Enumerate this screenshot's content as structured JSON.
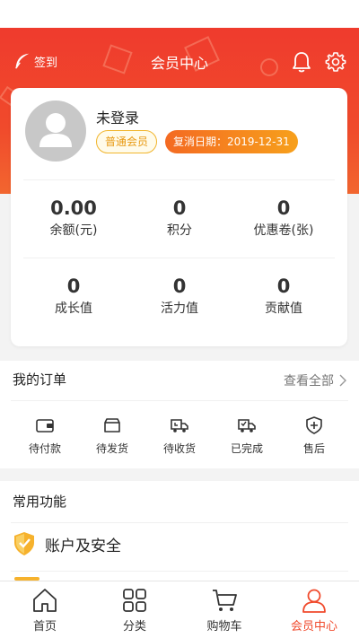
{
  "header": {
    "signin_label": "签到",
    "title": "会员中心"
  },
  "profile": {
    "login_status": "未登录",
    "member_level": "普通会员",
    "renewal_date_label": "复消日期：2019-12-31"
  },
  "stats": [
    {
      "value": "0.00",
      "label": "余额(元)"
    },
    {
      "value": "0",
      "label": "积分"
    },
    {
      "value": "0",
      "label": "优惠卷(张)"
    },
    {
      "value": "0",
      "label": "成长值"
    },
    {
      "value": "0",
      "label": "活力值"
    },
    {
      "value": "0",
      "label": "贡献值"
    }
  ],
  "orders": {
    "title": "我的订单",
    "view_all": "查看全部",
    "items": [
      {
        "label": "待付款",
        "icon": "wallet-icon"
      },
      {
        "label": "待发货",
        "icon": "box-icon"
      },
      {
        "label": "待收货",
        "icon": "truck-icon"
      },
      {
        "label": "已完成",
        "icon": "truck-done-icon"
      },
      {
        "label": "售后",
        "icon": "shield-plus-icon"
      }
    ]
  },
  "features": {
    "title": "常用功能",
    "items": [
      {
        "label": "账户及安全",
        "icon": "shield-icon"
      }
    ]
  },
  "tabbar": {
    "items": [
      {
        "label": "首页",
        "icon": "home-icon"
      },
      {
        "label": "分类",
        "icon": "grid-icon"
      },
      {
        "label": "购物车",
        "icon": "cart-icon"
      },
      {
        "label": "会员中心",
        "icon": "user-icon"
      }
    ],
    "active_index": 3
  },
  "colors": {
    "brand": "#f04a2c",
    "badge_gold": "#f1b52d",
    "badge_orange": "#f46a22"
  }
}
